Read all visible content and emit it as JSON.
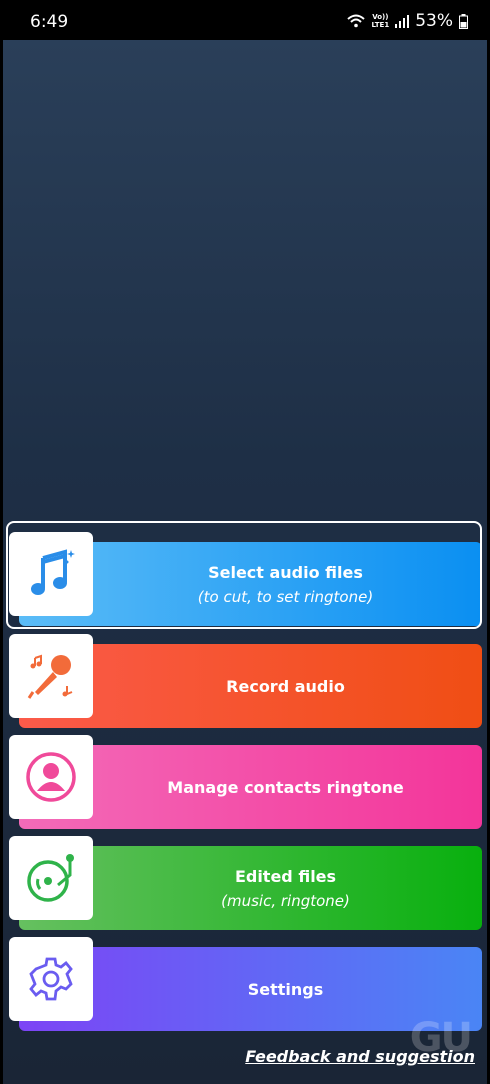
{
  "status": {
    "time": "6:49",
    "volte_line1": "Vo))",
    "volte_line2": "LTE1",
    "battery": "53%"
  },
  "menu": [
    {
      "label": "Select audio files",
      "sub": "(to cut, to set ringtone)",
      "icon": "music-note-icon"
    },
    {
      "label": "Record audio",
      "sub": "",
      "icon": "microphone-icon"
    },
    {
      "label": "Manage contacts ringtone",
      "sub": "",
      "icon": "contact-avatar-icon"
    },
    {
      "label": "Edited files",
      "sub": "(music, ringtone)",
      "icon": "turntable-icon"
    },
    {
      "label": "Settings",
      "sub": "",
      "icon": "gear-icon"
    }
  ],
  "colors": {
    "select_audio": [
      "#5bbcf7",
      "#0a8ff2"
    ],
    "record_audio": [
      "#fb5a4a",
      "#f04e14"
    ],
    "manage_contacts": [
      "#f36bb8",
      "#f3359a"
    ],
    "edited_files": [
      "#66c060",
      "#08b00e"
    ],
    "settings": [
      "#7d44f5",
      "#4a85f5"
    ]
  },
  "feedback_link": "Feedback and suggestion",
  "watermark": "GU"
}
